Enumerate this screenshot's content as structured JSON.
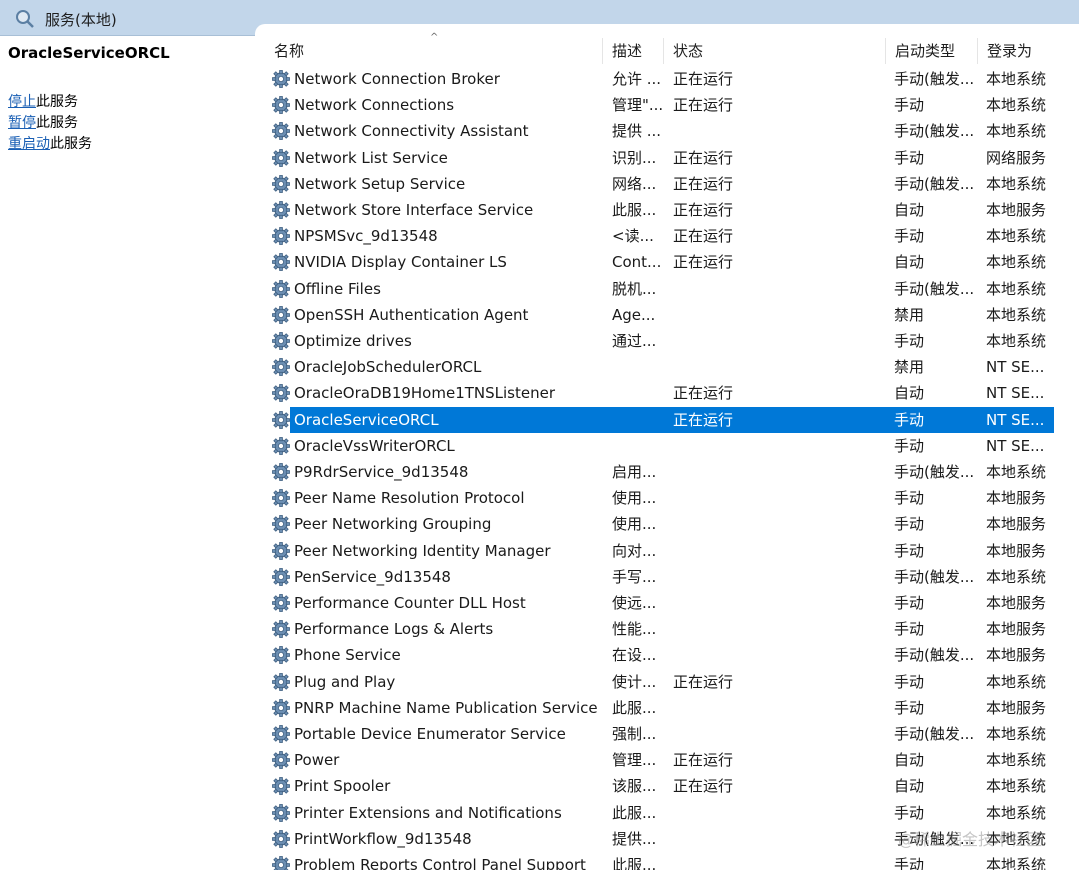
{
  "window": {
    "title": "服务(本地)"
  },
  "left_pane": {
    "service_name": "OracleServiceORCL",
    "actions": [
      {
        "link": "停止",
        "suffix": "此服务"
      },
      {
        "link": "暂停",
        "suffix": "此服务"
      },
      {
        "link": "重启动",
        "suffix": "此服务"
      }
    ]
  },
  "columns": {
    "name": "名称",
    "description": "描述",
    "status": "状态",
    "startup": "启动类型",
    "logon": "登录为"
  },
  "selected_row": "OracleServiceORCL",
  "services": [
    {
      "name": "Network Connection Broker",
      "description": "允许 ...",
      "status": "正在运行",
      "startup": "手动(触发...",
      "logon": "本地系统"
    },
    {
      "name": "Network Connections",
      "description": "管理\"...",
      "status": "正在运行",
      "startup": "手动",
      "logon": "本地系统"
    },
    {
      "name": "Network Connectivity Assistant",
      "description": "提供 ...",
      "status": "",
      "startup": "手动(触发...",
      "logon": "本地系统"
    },
    {
      "name": "Network List Service",
      "description": "识别...",
      "status": "正在运行",
      "startup": "手动",
      "logon": "网络服务"
    },
    {
      "name": "Network Setup Service",
      "description": "网络...",
      "status": "正在运行",
      "startup": "手动(触发...",
      "logon": "本地系统"
    },
    {
      "name": "Network Store Interface Service",
      "description": "此服...",
      "status": "正在运行",
      "startup": "自动",
      "logon": "本地服务"
    },
    {
      "name": "NPSMSvc_9d13548",
      "description": "<读...",
      "status": "正在运行",
      "startup": "手动",
      "logon": "本地系统"
    },
    {
      "name": "NVIDIA Display Container LS",
      "description": "Cont...",
      "status": "正在运行",
      "startup": "自动",
      "logon": "本地系统"
    },
    {
      "name": "Offline Files",
      "description": "脱机...",
      "status": "",
      "startup": "手动(触发...",
      "logon": "本地系统"
    },
    {
      "name": "OpenSSH Authentication Agent",
      "description": "Age...",
      "status": "",
      "startup": "禁用",
      "logon": "本地系统"
    },
    {
      "name": "Optimize drives",
      "description": "通过...",
      "status": "",
      "startup": "手动",
      "logon": "本地系统"
    },
    {
      "name": "OracleJobSchedulerORCL",
      "description": "",
      "status": "",
      "startup": "禁用",
      "logon": "NT SE..."
    },
    {
      "name": "OracleOraDB19Home1TNSListener",
      "description": "",
      "status": "正在运行",
      "startup": "自动",
      "logon": "NT SE..."
    },
    {
      "name": "OracleServiceORCL",
      "description": "",
      "status": "正在运行",
      "startup": "手动",
      "logon": "NT SE..."
    },
    {
      "name": "OracleVssWriterORCL",
      "description": "",
      "status": "",
      "startup": "手动",
      "logon": "NT SE..."
    },
    {
      "name": "P9RdrService_9d13548",
      "description": "启用...",
      "status": "",
      "startup": "手动(触发...",
      "logon": "本地系统"
    },
    {
      "name": "Peer Name Resolution Protocol",
      "description": "使用...",
      "status": "",
      "startup": "手动",
      "logon": "本地服务"
    },
    {
      "name": "Peer Networking Grouping",
      "description": "使用...",
      "status": "",
      "startup": "手动",
      "logon": "本地服务"
    },
    {
      "name": "Peer Networking Identity Manager",
      "description": "向对...",
      "status": "",
      "startup": "手动",
      "logon": "本地服务"
    },
    {
      "name": "PenService_9d13548",
      "description": "手写...",
      "status": "",
      "startup": "手动(触发...",
      "logon": "本地系统"
    },
    {
      "name": "Performance Counter DLL Host",
      "description": "使远...",
      "status": "",
      "startup": "手动",
      "logon": "本地服务"
    },
    {
      "name": "Performance Logs & Alerts",
      "description": "性能...",
      "status": "",
      "startup": "手动",
      "logon": "本地服务"
    },
    {
      "name": "Phone Service",
      "description": "在设...",
      "status": "",
      "startup": "手动(触发...",
      "logon": "本地服务"
    },
    {
      "name": "Plug and Play",
      "description": "使计...",
      "status": "正在运行",
      "startup": "手动",
      "logon": "本地系统"
    },
    {
      "name": "PNRP Machine Name Publication Service",
      "description": "此服...",
      "status": "",
      "startup": "手动",
      "logon": "本地服务"
    },
    {
      "name": "Portable Device Enumerator Service",
      "description": "强制...",
      "status": "",
      "startup": "手动(触发...",
      "logon": "本地系统"
    },
    {
      "name": "Power",
      "description": "管理...",
      "status": "正在运行",
      "startup": "自动",
      "logon": "本地系统"
    },
    {
      "name": "Print Spooler",
      "description": "该服...",
      "status": "正在运行",
      "startup": "自动",
      "logon": "本地系统"
    },
    {
      "name": "Printer Extensions and Notifications",
      "description": "此服...",
      "status": "",
      "startup": "手动",
      "logon": "本地系统"
    },
    {
      "name": "PrintWorkflow_9d13548",
      "description": "提供...",
      "status": "",
      "startup": "手动(触发...",
      "logon": "本地系统"
    },
    {
      "name": "Problem Reports Control Panel Support",
      "description": "此服...",
      "status": "",
      "startup": "手动",
      "logon": "本地系统"
    }
  ],
  "watermark": "@稀土掘金技术社区"
}
